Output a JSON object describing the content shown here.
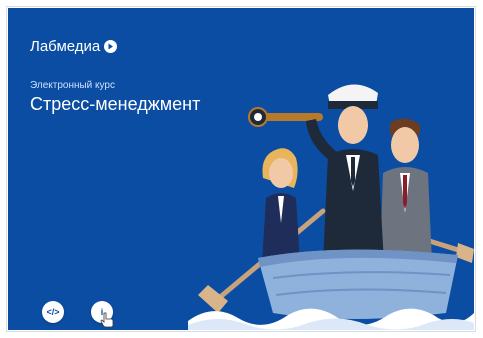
{
  "brand": {
    "name": "Лабмедиа"
  },
  "course": {
    "subtitle": "Электронный курс",
    "title": "Стресс-менеджмент"
  },
  "controls": {
    "embed_glyph": "</>",
    "info_glyph": "i"
  },
  "colors": {
    "background": "#0b4da3",
    "boat": "#8fb2dc",
    "wave": "#ffffff"
  },
  "icons": [
    "play-icon",
    "code-icon",
    "info-icon",
    "cursor-icon"
  ]
}
